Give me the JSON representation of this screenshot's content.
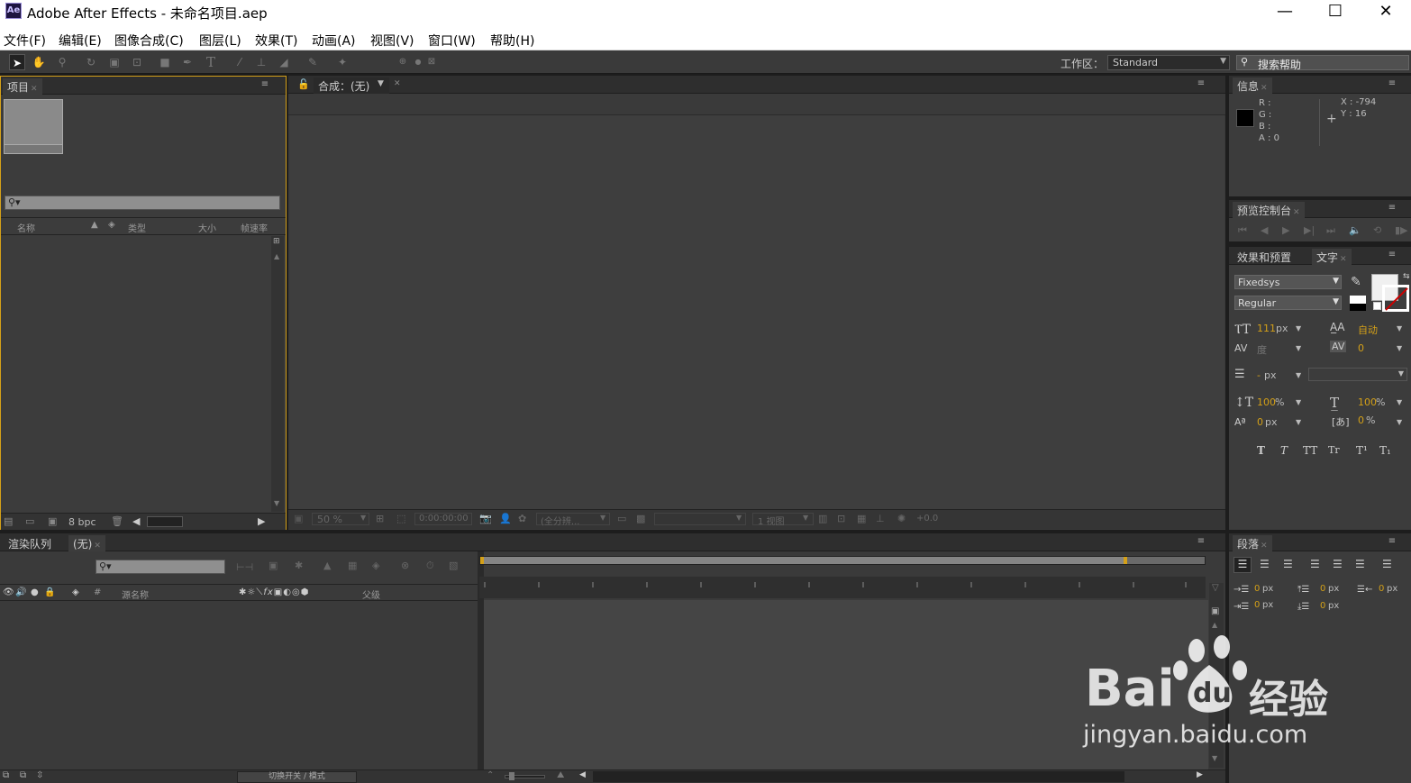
{
  "app": {
    "logo": "Ae",
    "title": "Adobe After Effects - 未命名项目.aep",
    "minimize": "—",
    "maximize": "☐",
    "close": "✕"
  },
  "menu": [
    "文件(F)",
    "编辑(E)",
    "图像合成(C)",
    "图层(L)",
    "效果(T)",
    "动画(A)",
    "视图(V)",
    "窗口(W)",
    "帮助(H)"
  ],
  "toolbar": {
    "workspace_label": "工作区：",
    "workspace_value": "Standard",
    "search_help": "搜索帮助"
  },
  "project": {
    "tab": "项目",
    "search_placeholder": "",
    "columns": [
      "名称",
      "类型",
      "大小",
      "帧速率"
    ],
    "bpc": "8 bpc"
  },
  "composition": {
    "tab": "合成：(无)",
    "zoom": "50 %",
    "timecode": "0:00:00:00",
    "resolution": "(全分辨...",
    "views": "1 视图",
    "exposure": "+0.0"
  },
  "info": {
    "tab": "信息",
    "r": "R :",
    "g": "G :",
    "b": "B :",
    "a": "A : 0",
    "x": "X : -794",
    "y": "Y : 16"
  },
  "preview": {
    "tab": "预览控制台"
  },
  "character": {
    "tab_effects": "效果和预置",
    "tab_text": "文字",
    "font": "Fixedsys",
    "style": "Regular",
    "size": "111",
    "size_unit": "px",
    "leading": "自动",
    "kerning": "度",
    "tracking": "0",
    "stroke": "-",
    "stroke_unit": "px",
    "v_scale": "100",
    "h_scale": "100",
    "pct": "%",
    "baseline": "0",
    "baseline_unit": "px",
    "tsume": "0",
    "tsume_unit": "%",
    "styles": [
      "T",
      "T",
      "TT",
      "Tr",
      "T¹",
      "T₁"
    ]
  },
  "paragraph": {
    "tab": "段落",
    "indent_left": "0",
    "indent_first": "0",
    "space_before": "0",
    "indent_right": "0",
    "space_after": "0",
    "unit": "px"
  },
  "timeline": {
    "tab_render": "渲染队列",
    "tab_comp": "(无)",
    "col_source": "源名称",
    "col_parent": "父级",
    "col_hash": "#",
    "toggle_label": "切换开关 / 模式"
  },
  "watermark": {
    "brand": "Bai",
    "brand2": "du",
    "brand_cn": "经验",
    "url": "jingyan.baidu.com"
  },
  "colors": {
    "accent": "#d4a018",
    "panel_bg": "#3c3c3c",
    "dark_bg": "#1d1d1d"
  }
}
